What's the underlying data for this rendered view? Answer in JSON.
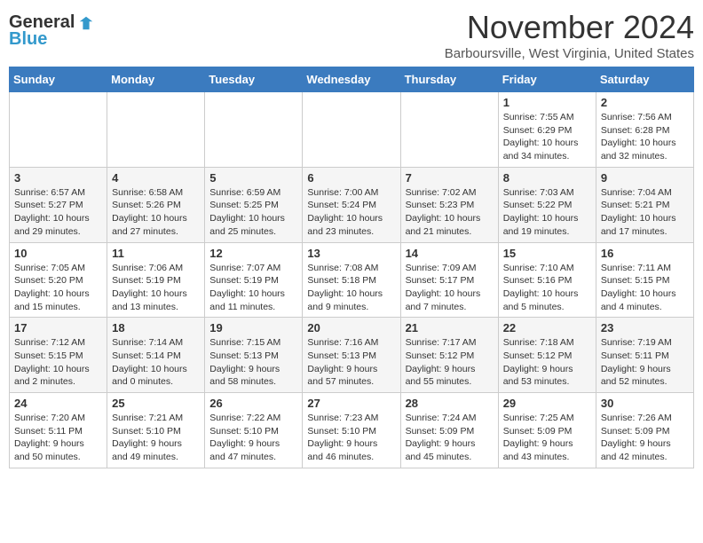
{
  "header": {
    "logo_general": "General",
    "logo_blue": "Blue",
    "month_title": "November 2024",
    "location": "Barboursville, West Virginia, United States"
  },
  "weekdays": [
    "Sunday",
    "Monday",
    "Tuesday",
    "Wednesday",
    "Thursday",
    "Friday",
    "Saturday"
  ],
  "weeks": [
    [
      {
        "day": "",
        "info": ""
      },
      {
        "day": "",
        "info": ""
      },
      {
        "day": "",
        "info": ""
      },
      {
        "day": "",
        "info": ""
      },
      {
        "day": "",
        "info": ""
      },
      {
        "day": "1",
        "info": "Sunrise: 7:55 AM\nSunset: 6:29 PM\nDaylight: 10 hours and 34 minutes."
      },
      {
        "day": "2",
        "info": "Sunrise: 7:56 AM\nSunset: 6:28 PM\nDaylight: 10 hours and 32 minutes."
      }
    ],
    [
      {
        "day": "3",
        "info": "Sunrise: 6:57 AM\nSunset: 5:27 PM\nDaylight: 10 hours and 29 minutes."
      },
      {
        "day": "4",
        "info": "Sunrise: 6:58 AM\nSunset: 5:26 PM\nDaylight: 10 hours and 27 minutes."
      },
      {
        "day": "5",
        "info": "Sunrise: 6:59 AM\nSunset: 5:25 PM\nDaylight: 10 hours and 25 minutes."
      },
      {
        "day": "6",
        "info": "Sunrise: 7:00 AM\nSunset: 5:24 PM\nDaylight: 10 hours and 23 minutes."
      },
      {
        "day": "7",
        "info": "Sunrise: 7:02 AM\nSunset: 5:23 PM\nDaylight: 10 hours and 21 minutes."
      },
      {
        "day": "8",
        "info": "Sunrise: 7:03 AM\nSunset: 5:22 PM\nDaylight: 10 hours and 19 minutes."
      },
      {
        "day": "9",
        "info": "Sunrise: 7:04 AM\nSunset: 5:21 PM\nDaylight: 10 hours and 17 minutes."
      }
    ],
    [
      {
        "day": "10",
        "info": "Sunrise: 7:05 AM\nSunset: 5:20 PM\nDaylight: 10 hours and 15 minutes."
      },
      {
        "day": "11",
        "info": "Sunrise: 7:06 AM\nSunset: 5:19 PM\nDaylight: 10 hours and 13 minutes."
      },
      {
        "day": "12",
        "info": "Sunrise: 7:07 AM\nSunset: 5:19 PM\nDaylight: 10 hours and 11 minutes."
      },
      {
        "day": "13",
        "info": "Sunrise: 7:08 AM\nSunset: 5:18 PM\nDaylight: 10 hours and 9 minutes."
      },
      {
        "day": "14",
        "info": "Sunrise: 7:09 AM\nSunset: 5:17 PM\nDaylight: 10 hours and 7 minutes."
      },
      {
        "day": "15",
        "info": "Sunrise: 7:10 AM\nSunset: 5:16 PM\nDaylight: 10 hours and 5 minutes."
      },
      {
        "day": "16",
        "info": "Sunrise: 7:11 AM\nSunset: 5:15 PM\nDaylight: 10 hours and 4 minutes."
      }
    ],
    [
      {
        "day": "17",
        "info": "Sunrise: 7:12 AM\nSunset: 5:15 PM\nDaylight: 10 hours and 2 minutes."
      },
      {
        "day": "18",
        "info": "Sunrise: 7:14 AM\nSunset: 5:14 PM\nDaylight: 10 hours and 0 minutes."
      },
      {
        "day": "19",
        "info": "Sunrise: 7:15 AM\nSunset: 5:13 PM\nDaylight: 9 hours and 58 minutes."
      },
      {
        "day": "20",
        "info": "Sunrise: 7:16 AM\nSunset: 5:13 PM\nDaylight: 9 hours and 57 minutes."
      },
      {
        "day": "21",
        "info": "Sunrise: 7:17 AM\nSunset: 5:12 PM\nDaylight: 9 hours and 55 minutes."
      },
      {
        "day": "22",
        "info": "Sunrise: 7:18 AM\nSunset: 5:12 PM\nDaylight: 9 hours and 53 minutes."
      },
      {
        "day": "23",
        "info": "Sunrise: 7:19 AM\nSunset: 5:11 PM\nDaylight: 9 hours and 52 minutes."
      }
    ],
    [
      {
        "day": "24",
        "info": "Sunrise: 7:20 AM\nSunset: 5:11 PM\nDaylight: 9 hours and 50 minutes."
      },
      {
        "day": "25",
        "info": "Sunrise: 7:21 AM\nSunset: 5:10 PM\nDaylight: 9 hours and 49 minutes."
      },
      {
        "day": "26",
        "info": "Sunrise: 7:22 AM\nSunset: 5:10 PM\nDaylight: 9 hours and 47 minutes."
      },
      {
        "day": "27",
        "info": "Sunrise: 7:23 AM\nSunset: 5:10 PM\nDaylight: 9 hours and 46 minutes."
      },
      {
        "day": "28",
        "info": "Sunrise: 7:24 AM\nSunset: 5:09 PM\nDaylight: 9 hours and 45 minutes."
      },
      {
        "day": "29",
        "info": "Sunrise: 7:25 AM\nSunset: 5:09 PM\nDaylight: 9 hours and 43 minutes."
      },
      {
        "day": "30",
        "info": "Sunrise: 7:26 AM\nSunset: 5:09 PM\nDaylight: 9 hours and 42 minutes."
      }
    ]
  ],
  "row_classes": [
    "row-1",
    "row-2",
    "row-3",
    "row-4",
    "row-5"
  ]
}
